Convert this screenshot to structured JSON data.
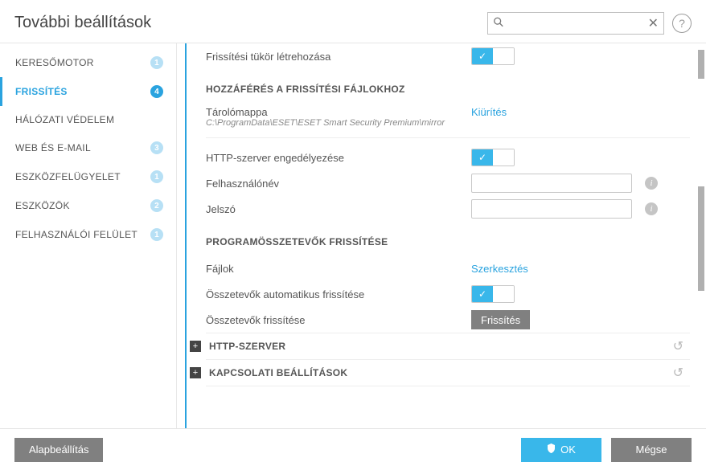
{
  "header": {
    "title": "További beállítások",
    "search_placeholder": "",
    "search_value": ""
  },
  "sidebar": {
    "items": [
      {
        "label": "KERESŐMOTOR",
        "badge": "1",
        "active": false
      },
      {
        "label": "FRISSÍTÉS",
        "badge": "4",
        "active": true
      },
      {
        "label": "HÁLÓZATI VÉDELEM",
        "badge": "",
        "active": false
      },
      {
        "label": "WEB ÉS E-MAIL",
        "badge": "3",
        "active": false
      },
      {
        "label": "ESZKÖZFELÜGYELET",
        "badge": "1",
        "active": false
      },
      {
        "label": "ESZKÖZÖK",
        "badge": "2",
        "active": false
      },
      {
        "label": "FELHASZNÁLÓI FELÜLET",
        "badge": "1",
        "active": false
      }
    ]
  },
  "main": {
    "mirror_row_label": "Frissítési tükör létrehozása",
    "section_access_title": "HOZZÁFÉRÉS A FRISSÍTÉSI FÁJLOKHOZ",
    "storage_label": "Tárolómappa",
    "storage_path": "C:\\ProgramData\\ESET\\ESET Smart Security Premium\\mirror",
    "clear_link": "Kiürítés",
    "http_enable_label": "HTTP-szerver engedélyezése",
    "username_label": "Felhasználónév",
    "password_label": "Jelszó",
    "section_components_title": "PROGRAMÖSSZETEVŐK FRISSÍTÉSE",
    "files_label": "Fájlok",
    "edit_link": "Szerkesztés",
    "auto_update_label": "Összetevők automatikus frissítése",
    "update_comp_label": "Összetevők frissítése",
    "update_btn": "Frissítés",
    "expand1": "HTTP-SZERVER",
    "expand2": "KAPCSOLATI BEÁLLÍTÁSOK"
  },
  "footer": {
    "default_btn": "Alapbeállítás",
    "ok_btn": "OK",
    "cancel_btn": "Mégse"
  }
}
